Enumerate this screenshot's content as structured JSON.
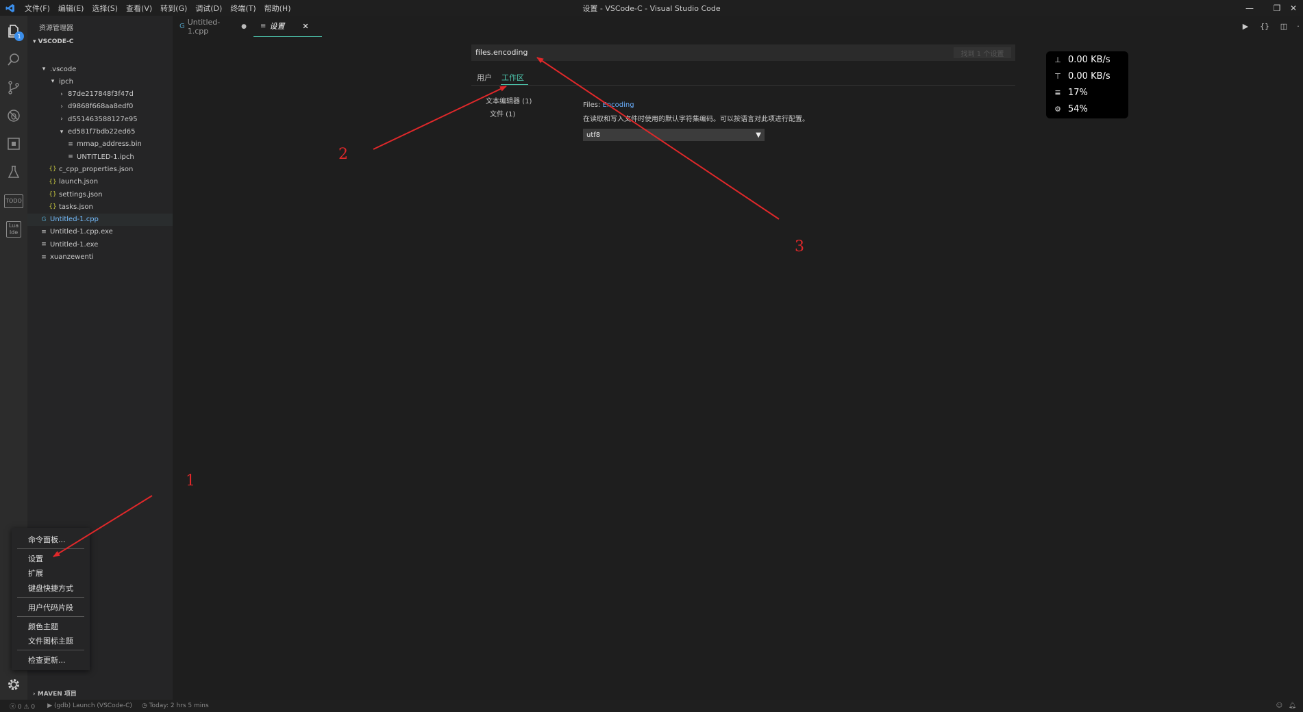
{
  "titlebar": {
    "title": "设置 - VSCode-C - Visual Studio Code",
    "menu": [
      "文件(F)",
      "编辑(E)",
      "选择(S)",
      "查看(V)",
      "转到(G)",
      "调试(D)",
      "终端(T)",
      "帮助(H)"
    ]
  },
  "activitybar": {
    "explorer_badge": "1",
    "todo_label": "TODO",
    "luaide_label": "Lua Ide"
  },
  "sidebar": {
    "title": "资源管理器",
    "folder": "VSCODE-C",
    "tree": [
      {
        "label": ".vscode",
        "icon": "open",
        "kind": "folder"
      },
      {
        "label": "ipch",
        "icon": "open",
        "kind": "folder"
      },
      {
        "label": "87de217848f3f47d",
        "icon": "closed",
        "kind": "folder"
      },
      {
        "label": "d9868f668aa8edf0",
        "icon": "closed",
        "kind": "folder"
      },
      {
        "label": "d551463588127e95",
        "icon": "closed",
        "kind": "folder"
      },
      {
        "label": "ed581f7bdb22ed65",
        "icon": "open",
        "kind": "folder"
      },
      {
        "label": "mmap_address.bin",
        "icon": "file",
        "kind": "file"
      },
      {
        "label": "UNTITLED-1.ipch",
        "icon": "file",
        "kind": "file"
      },
      {
        "label": "c_cpp_properties.json",
        "icon": "json",
        "kind": "file"
      },
      {
        "label": "launch.json",
        "icon": "json",
        "kind": "file"
      },
      {
        "label": "settings.json",
        "icon": "json",
        "kind": "file"
      },
      {
        "label": "tasks.json",
        "icon": "json",
        "kind": "file"
      },
      {
        "label": "Untitled-1.cpp",
        "icon": "cpp",
        "kind": "file"
      },
      {
        "label": "Untitled-1.cpp.exe",
        "icon": "file",
        "kind": "file"
      },
      {
        "label": "Untitled-1.exe",
        "icon": "file",
        "kind": "file"
      },
      {
        "label": "xuanzewenti",
        "icon": "file",
        "kind": "file"
      }
    ],
    "maven": "MAVEN 项目"
  },
  "context_menu": {
    "items": [
      "命令面板...",
      "设置",
      "扩展",
      "键盘快捷方式",
      "用户代码片段",
      "颜色主题",
      "文件图标主题",
      "检查更新..."
    ]
  },
  "tabs": [
    {
      "label": "Untitled-1.cpp",
      "modified": "●"
    },
    {
      "label": "设置",
      "close": "✕"
    }
  ],
  "settings": {
    "search_value": "files.encoding",
    "search_count": "找到 1 个设置",
    "scope_tabs": [
      "用户",
      "工作区"
    ],
    "toc": [
      "文本编辑器 (1)",
      "文件 (1)"
    ],
    "setting_key": "Files: ",
    "setting_name": "Encoding",
    "setting_desc": "在读取和写入文件时使用的默认字符集编码。可以按语言对此项进行配置。",
    "select_value": "utf8"
  },
  "net_widget": {
    "download": "0.00 KB/s",
    "upload": "0.00 KB/s",
    "memory": "17%",
    "cpu": "54%"
  },
  "annotations": [
    "1",
    "2",
    "3"
  ],
  "statusbar": {
    "errors": "0",
    "warnings": "0",
    "debug": "(gdb) Launch (VSCode-C)",
    "time": "Today: 2 hrs 5 mins"
  },
  "colors": {
    "accent": "#4ec9b0",
    "annotation": "#e0282a",
    "badge": "#3b8eea"
  }
}
